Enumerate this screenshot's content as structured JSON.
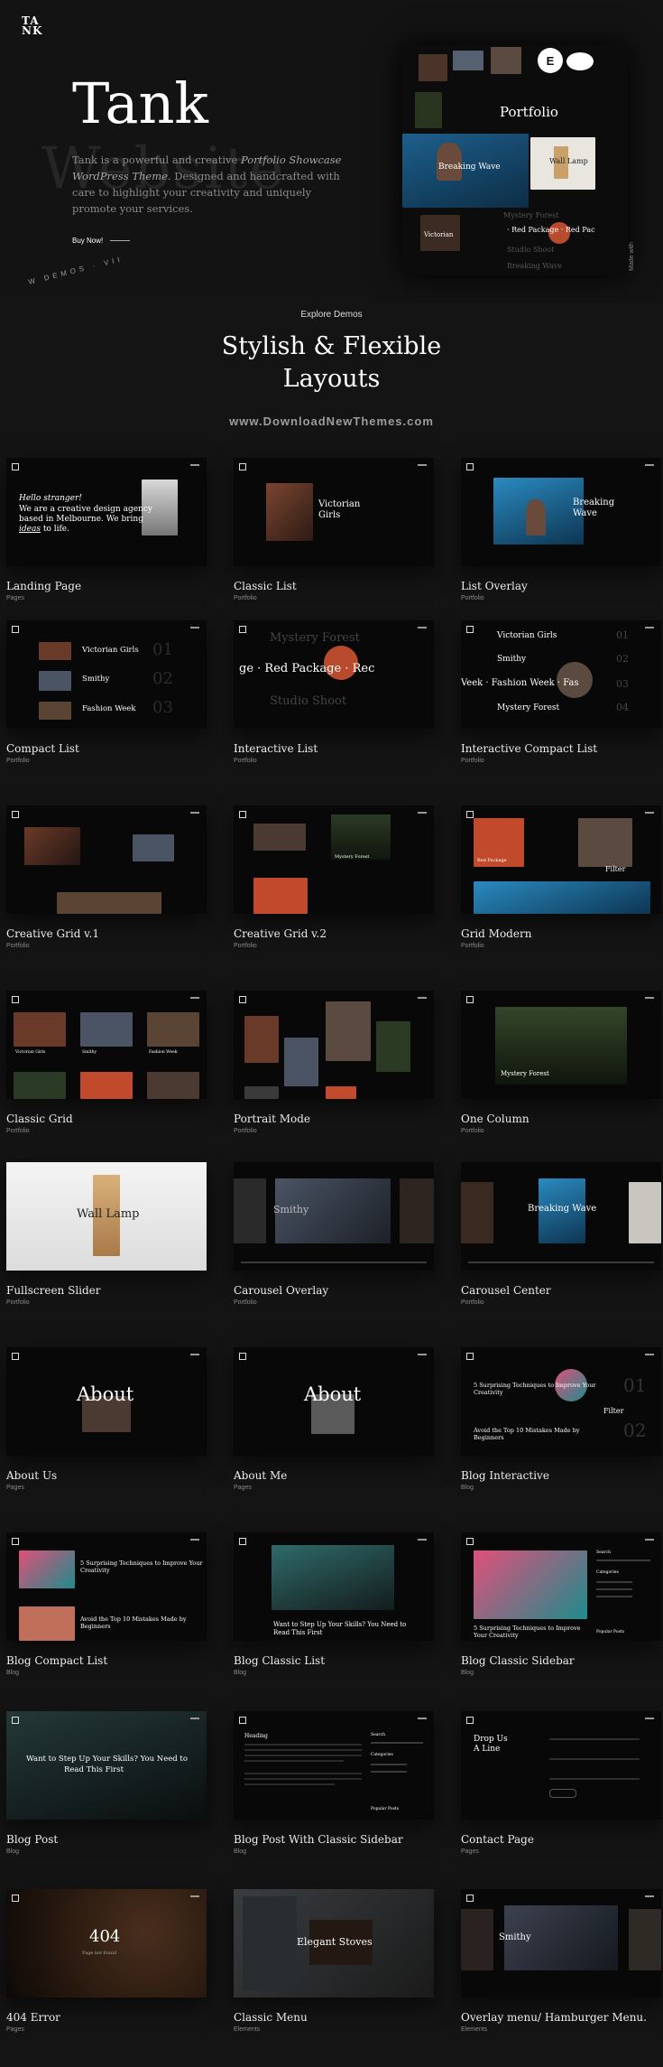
{
  "hero": {
    "logo_top": "TA",
    "logo_bottom": "NK",
    "ghost_word": "Website",
    "title": "Tank",
    "desc_1": "Tank is a powerful and creative ",
    "desc_em": "Portfolio Showcase WordPress Theme.",
    "desc_2": " Designed and handcrafted with care to highlight your creativity and uniquely promote your services.",
    "buy_label": "Buy Now!",
    "arc_text": "W DEMOS · VII",
    "mock": {
      "elementor_badge": "E",
      "portfolio_label": "Portfolio",
      "breaking_wave": "Breaking Wave",
      "wall_lamp": "Wall Lamp",
      "mystery_forest": "Mystery Forest",
      "red_package": "· Red Package · Red Pac",
      "studio_shoot": "Studio Shoot",
      "breaking_wave_2": "Breaking Wave",
      "victorian": "Victorian"
    },
    "made_with": "Made with"
  },
  "section": {
    "eyebrow": "Explore Demos",
    "title_line1": "Stylish & Flexible",
    "title_line2": "Layouts",
    "watermark": "www.DownloadNewThemes.com"
  },
  "cards": [
    {
      "title": "Landing Page",
      "sub": "Pages"
    },
    {
      "title": "Classic List",
      "sub": "Portfolio"
    },
    {
      "title": "List Overlay",
      "sub": "Portfolio"
    },
    {
      "title": "Compact List",
      "sub": "Portfolio"
    },
    {
      "title": "Interactive List",
      "sub": "Portfolio"
    },
    {
      "title": "Interactive Compact List",
      "sub": "Portfolio"
    },
    {
      "title": "Creative Grid v.1",
      "sub": "Portfolio"
    },
    {
      "title": "Creative Grid v.2",
      "sub": "Portfolio"
    },
    {
      "title": "Grid Modern",
      "sub": "Portfolio"
    },
    {
      "title": "Classic Grid",
      "sub": "Portfolio"
    },
    {
      "title": "Portrait Mode",
      "sub": "Portfolio"
    },
    {
      "title": "One Column",
      "sub": "Portfolio"
    },
    {
      "title": "Fullscreen Slider",
      "sub": "Portfolio"
    },
    {
      "title": "Carousel Overlay",
      "sub": "Portfolio"
    },
    {
      "title": "Carousel Center",
      "sub": "Portfolio"
    },
    {
      "title": "About Us",
      "sub": "Pages"
    },
    {
      "title": "About Me",
      "sub": "Pages"
    },
    {
      "title": "Blog Interactive",
      "sub": "Blog"
    },
    {
      "title": "Blog Compact List",
      "sub": "Blog"
    },
    {
      "title": "Blog Classic List",
      "sub": "Blog"
    },
    {
      "title": "Blog Classic Sidebar",
      "sub": "Blog"
    },
    {
      "title": "Blog Post",
      "sub": "Blog"
    },
    {
      "title": "Blog Post With Classic Sidebar",
      "sub": "Blog"
    },
    {
      "title": "Contact Page",
      "sub": "Pages"
    },
    {
      "title": "404 Error",
      "sub": "Pages"
    },
    {
      "title": "Classic Menu",
      "sub": "Elements"
    },
    {
      "title": "Overlay menu/ Hamburger Menu.",
      "sub": "Elements"
    }
  ],
  "thumbs": {
    "landing": {
      "l1": "Hello stranger!",
      "l2": "We are a creative design agency",
      "l3": "based in Melbourne. We bring",
      "l4a": "ideas",
      "l4b": " to life."
    },
    "classic_list": {
      "l1": "Victorian",
      "l2": "Girls"
    },
    "list_overlay": {
      "l1": "Breaking",
      "l2": "Wave"
    },
    "compact": {
      "r1": "Victorian Girls",
      "r2": "Smithy",
      "r3": "Fashion Week",
      "n1": "01",
      "n2": "02",
      "n3": "03"
    },
    "interactive": {
      "l1": "Mystery Forest",
      "l2": "ge · Red Package · Rec",
      "l3": "Studio Shoot"
    },
    "interactive_compact": {
      "r1": "Victorian Girls",
      "r2": "Smithy",
      "r3": "Veek · Fashion Week · Fas",
      "r4": "Mystery Forest",
      "n1": "01",
      "n2": "02",
      "n3": "03",
      "n4": "04"
    },
    "grid_v2": {
      "l1": "Mystery Forest"
    },
    "grid_modern": {
      "l1": "Red Package",
      "l2": "Filter"
    },
    "classic_grid": {
      "c1": "Victorian Girls",
      "c2": "Smithy",
      "c3": "Fashion Week"
    },
    "one_column": {
      "l1": "Mystery Forest"
    },
    "fullscreen": {
      "l1": "Wall Lamp"
    },
    "carousel_overlay": {
      "l1": "Smithy"
    },
    "carousel_center": {
      "l1": "Breaking Wave"
    },
    "about_us": {
      "l1": "About"
    },
    "about_me": {
      "l1": "About"
    },
    "blog_interactive": {
      "l1": "5 Surprising Techniques to Improve Your",
      "l2": "Creativity",
      "l3": "Avoid the Top 10 Mistakes Made by",
      "l4": "Beginners",
      "n1": "01",
      "n2": "02",
      "f": "Filter"
    },
    "blog_compact": {
      "l1": "5 Surprising Techniques to Improve Your",
      "l2": "Creativity",
      "l3": "Avoid the Top 10 Mistakes Made by",
      "l4": "Beginners"
    },
    "blog_classic": {
      "l1": "Want to Step Up Your Skills? You Need to",
      "l2": "Read This First"
    },
    "blog_sidebar": {
      "l1": "5 Surprising Techniques to Improve",
      "l2": "Your Creativity",
      "s1": "Search",
      "s2": "Categories",
      "s3": "Popular Posts"
    },
    "blog_post": {
      "l1": "Want to Step Up Your Skills? You Need to",
      "l2": "Read This First"
    },
    "blog_post_sidebar": {
      "h": "Heading",
      "s1": "Search",
      "s2": "Categories",
      "s3": "Popular Posts"
    },
    "contact": {
      "l1": "Drop Us",
      "l2": "A Line"
    },
    "error": {
      "l1": "404",
      "l2": "Page not found"
    },
    "classic_menu": {
      "l1": "Elegant Stoves"
    },
    "overlay_menu": {
      "l1": "Smithy"
    }
  },
  "colors": {
    "bg": "#141414",
    "card_bg": "#080808",
    "accent_red": "#c24a2c",
    "water": "#2a6f9a"
  }
}
